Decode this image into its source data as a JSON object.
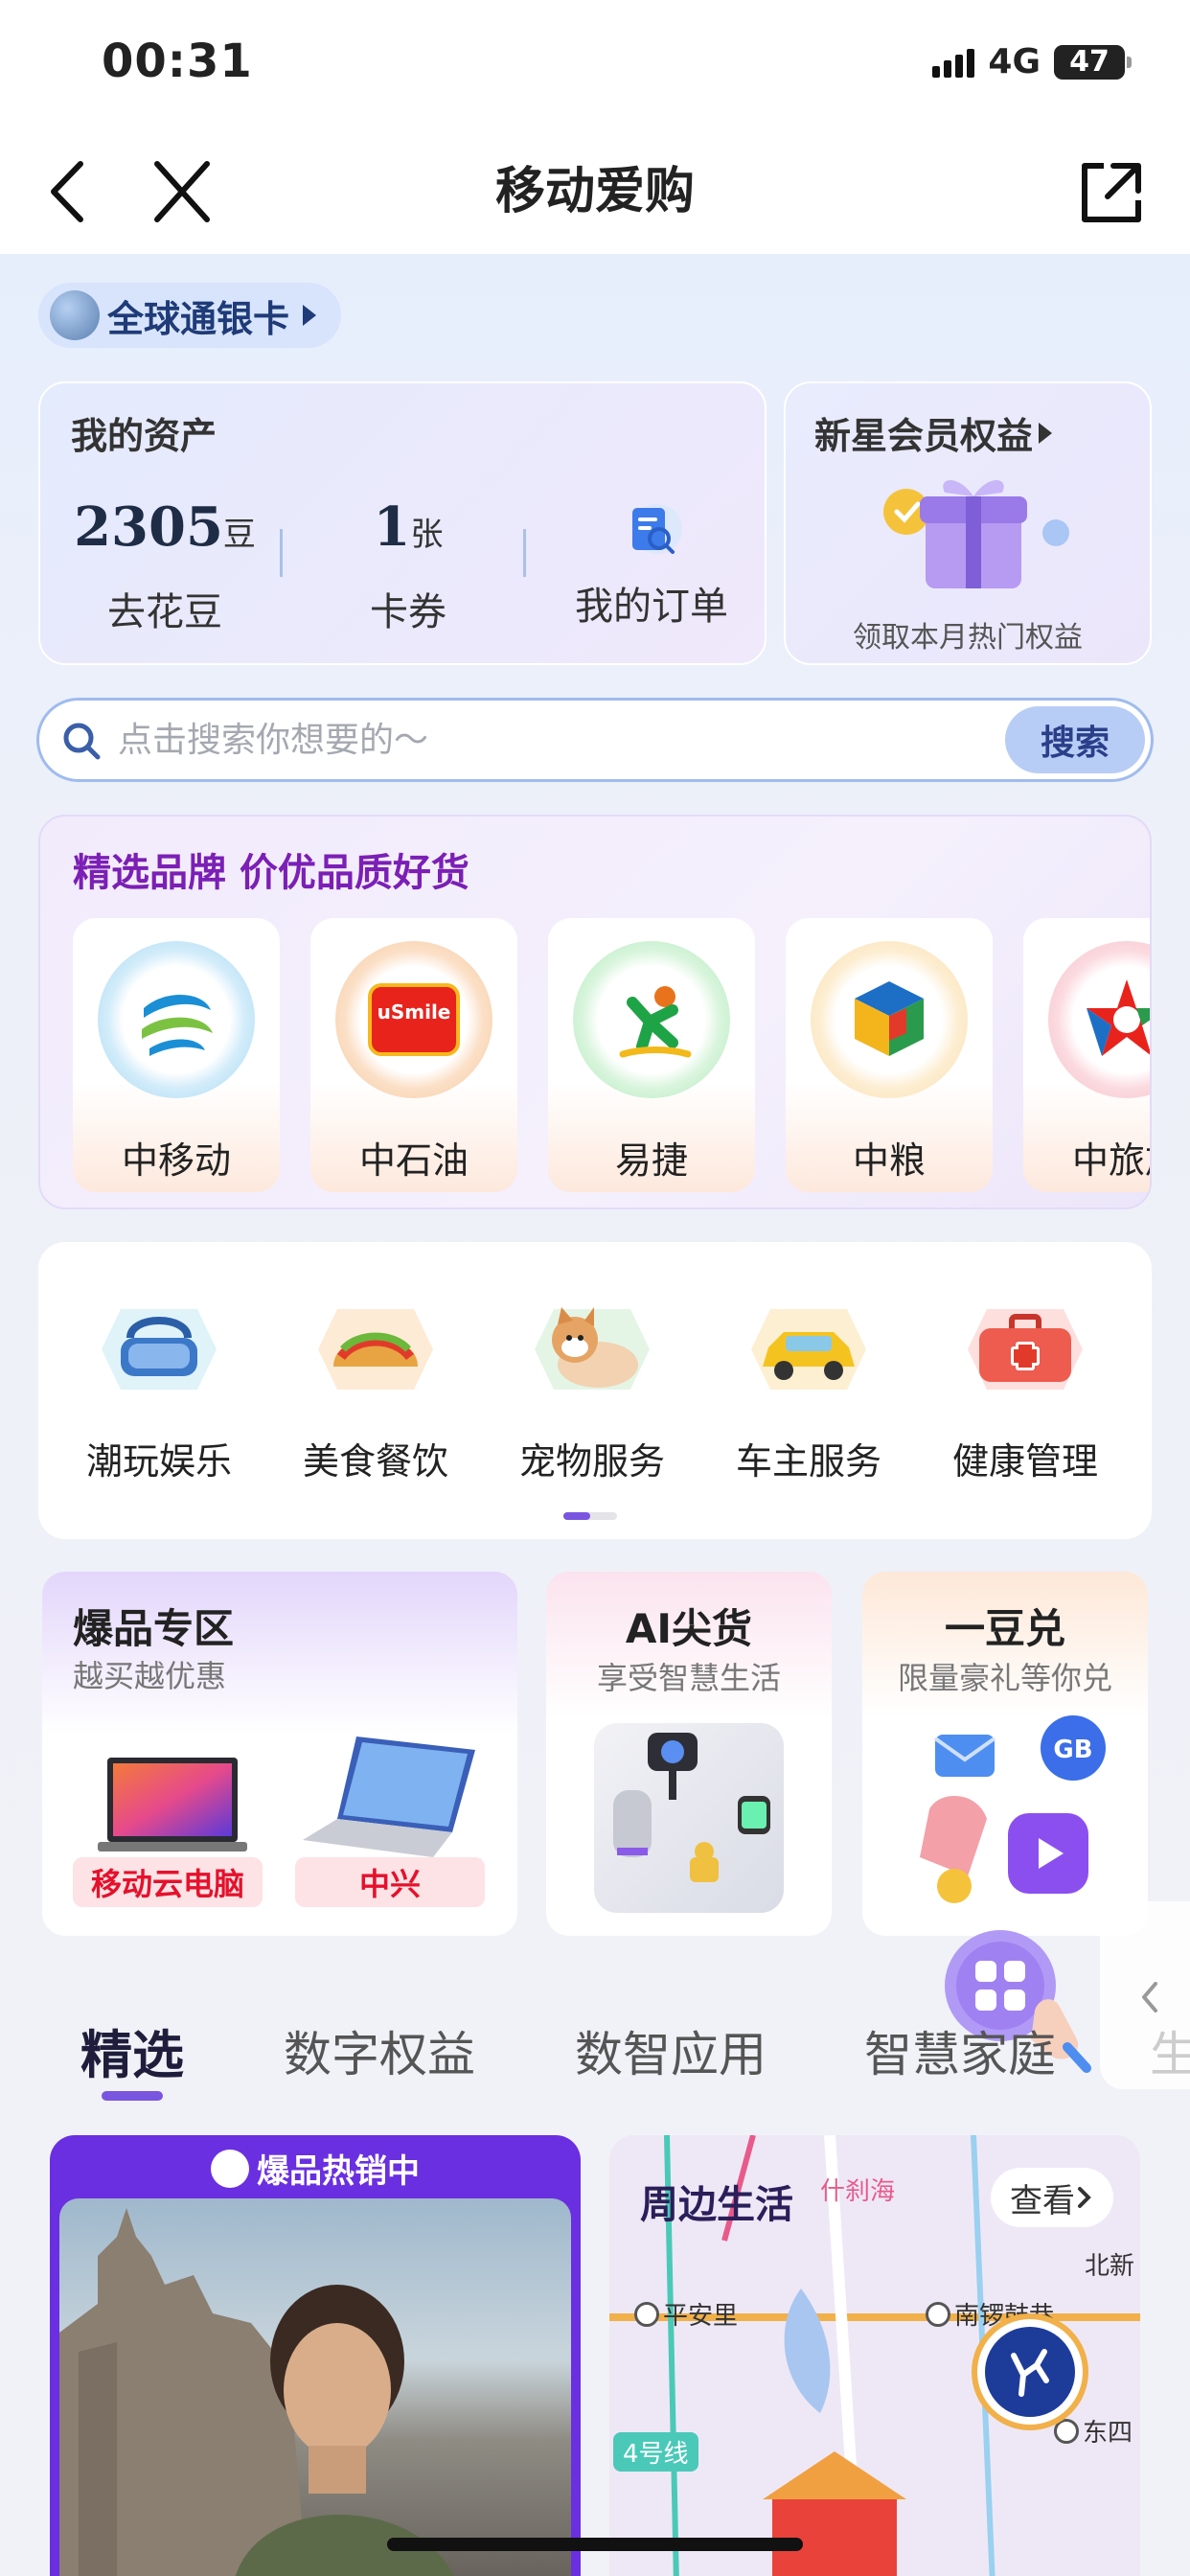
{
  "status_bar": {
    "time": "00:31",
    "network": "4G",
    "battery": "47"
  },
  "nav": {
    "title": "移动爱购"
  },
  "global_card": {
    "label": "全球通银卡"
  },
  "assets": {
    "title": "我的资产",
    "beans": {
      "value": "2305",
      "unit": "豆",
      "label": "去花豆"
    },
    "coupons": {
      "value": "1",
      "unit": "张",
      "label": "卡券"
    },
    "orders": {
      "label": "我的订单"
    }
  },
  "member": {
    "title": "新星会员权益",
    "subtitle": "领取本月热门权益"
  },
  "search": {
    "placeholder": "点击搜索你想要的～",
    "button": "搜索"
  },
  "brands": {
    "title": "精选品牌 价优品质好货",
    "items": [
      {
        "label": "中移动"
      },
      {
        "label": "中石油",
        "logo_text": "uSmile"
      },
      {
        "label": "易捷"
      },
      {
        "label": "中粮"
      },
      {
        "label": "中旅旅"
      }
    ]
  },
  "categories": {
    "items": [
      {
        "label": "潮玩娱乐",
        "icon": "vr-headset-icon"
      },
      {
        "label": "美食餐饮",
        "icon": "taco-icon"
      },
      {
        "label": "宠物服务",
        "icon": "shiba-dog-icon"
      },
      {
        "label": "车主服务",
        "icon": "car-icon"
      },
      {
        "label": "健康管理",
        "icon": "first-aid-kit-icon"
      }
    ]
  },
  "promos": {
    "hot": {
      "title": "爆品专区",
      "subtitle": "越买越优惠",
      "tag1": "移动云电脑",
      "tag2": "中兴"
    },
    "ai": {
      "title": "AI尖货",
      "subtitle": "享受智慧生活"
    },
    "bean": {
      "title": "一豆兑",
      "subtitle": "限量豪礼等你兑"
    }
  },
  "tabs": {
    "items": [
      "精选",
      "数字权益",
      "数智应用",
      "智慧家庭",
      "生"
    ]
  },
  "feed": {
    "hot_badge": "爆品热销中",
    "life": {
      "title": "周边生活",
      "view": "查看",
      "map_labels": {
        "a": "什刹海",
        "b": "北新",
        "c": "平安里",
        "d": "南锣鼓巷",
        "e": "东四",
        "line": "4号线"
      }
    }
  },
  "colors": {
    "accent": "#7a55e0",
    "brand_title": "#7b1fb5",
    "tag_red": "#e5112c"
  }
}
